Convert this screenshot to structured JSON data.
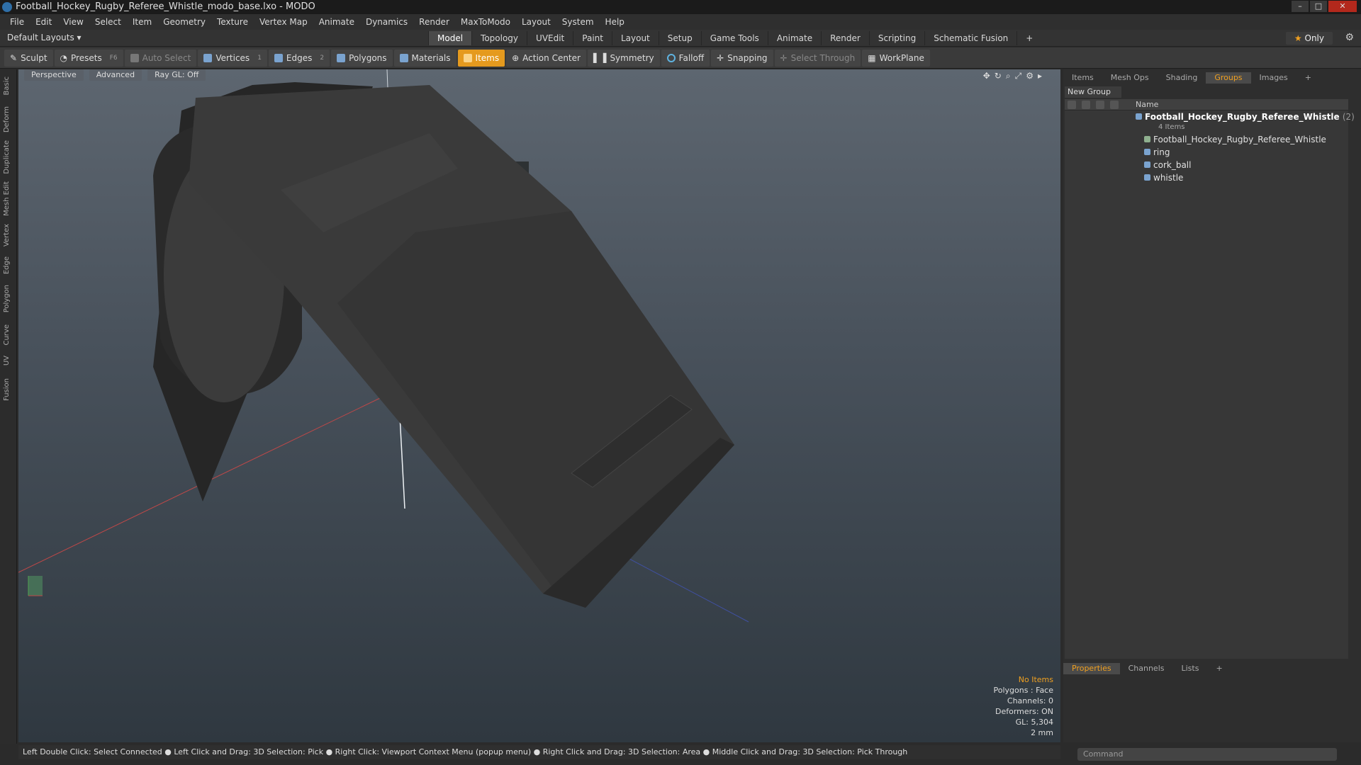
{
  "window": {
    "title": "Football_Hockey_Rugby_Referee_Whistle_modo_base.lxo - MODO",
    "controls": [
      "–",
      "□",
      "✕"
    ]
  },
  "menu": [
    "File",
    "Edit",
    "View",
    "Select",
    "Item",
    "Geometry",
    "Texture",
    "Vertex Map",
    "Animate",
    "Dynamics",
    "Render",
    "MaxToModo",
    "Layout",
    "System",
    "Help"
  ],
  "layout_bar": {
    "default_layouts": "Default Layouts ▾",
    "tabs": [
      "Model",
      "Topology",
      "UVEdit",
      "Paint",
      "Layout",
      "Setup",
      "Game Tools",
      "Animate",
      "Render",
      "Scripting",
      "Schematic Fusion",
      "+"
    ],
    "active_tab": "Model",
    "only": "Only"
  },
  "toolbar": {
    "sculpt": "Sculpt",
    "presets": "Presets",
    "presets_key": "F6",
    "auto_select": "Auto Select",
    "vertices": "Vertices",
    "vertices_count": "1",
    "edges": "Edges",
    "edges_count": "2",
    "polygons": "Polygons",
    "materials": "Materials",
    "items": "Items",
    "action_center": "Action Center",
    "symmetry": "Symmetry",
    "falloff": "Falloff",
    "snapping": "Snapping",
    "select_through": "Select Through",
    "workplane": "WorkPlane"
  },
  "left_tabs": [
    "Basic",
    "Deform",
    "Duplicate",
    "Mesh Edit",
    "Vertex",
    "Edge",
    "Polygon",
    "Curve",
    "UV",
    "Fusion"
  ],
  "viewport": {
    "view": "Perspective",
    "shading": "Advanced",
    "raygl": "Ray GL: Off",
    "stats": {
      "no_items": "No Items",
      "polygons": "Polygons : Face",
      "channels": "Channels: 0",
      "deformers": "Deformers: ON",
      "gl": "GL: 5,304",
      "units": "2 mm"
    }
  },
  "status_bar": "Left Double Click: Select Connected ● Left Click and Drag: 3D Selection: Pick ● Right Click: Viewport Context Menu (popup menu) ● Right Click and Drag: 3D Selection: Area ● Middle Click and Drag: 3D Selection: Pick Through",
  "right_panel": {
    "tabs": [
      "Items",
      "Mesh Ops",
      "Shading",
      "Groups",
      "Images",
      "+"
    ],
    "active_tab": "Groups",
    "new_group": "New Group",
    "column_name": "Name",
    "group": {
      "name": "Football_Hockey_Rugby_Referee_Whistle",
      "count": "(2)",
      "sub": "4 Items"
    },
    "items": [
      "Football_Hockey_Rugby_Referee_Whistle",
      "ring",
      "cork_ball",
      "whistle"
    ],
    "bottom_tabs": [
      "Properties",
      "Channels",
      "Lists",
      "+"
    ],
    "bottom_active": "Properties",
    "command_placeholder": "Command"
  },
  "colors": {
    "accent": "#e59a1e",
    "mesh_icon": "#7aa3cf",
    "whistle_body": "#3a3a3a",
    "cork": "#d9a35e"
  }
}
